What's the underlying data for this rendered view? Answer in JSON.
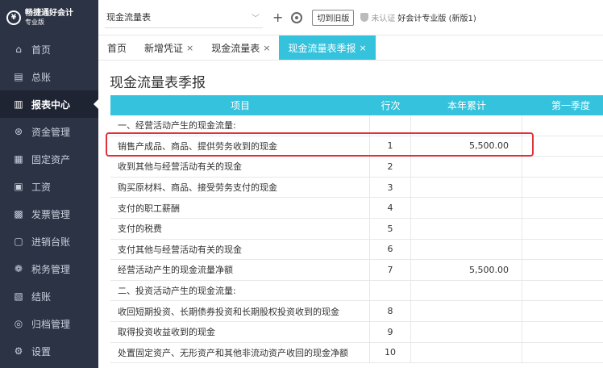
{
  "app": {
    "logo_glyph": "¥",
    "logo_name": "畅捷通好会计",
    "logo_sub": "专业版"
  },
  "sidebar": {
    "items": [
      {
        "label": "首页",
        "icon": "home-icon",
        "glyph": "⌂"
      },
      {
        "label": "总账",
        "icon": "ledger-icon",
        "glyph": "▤"
      },
      {
        "label": "报表中心",
        "icon": "chart-icon",
        "glyph": "▥",
        "active": true
      },
      {
        "label": "资金管理",
        "icon": "money-icon",
        "glyph": "⊛"
      },
      {
        "label": "固定资产",
        "icon": "asset-icon",
        "glyph": "▦"
      },
      {
        "label": "工资",
        "icon": "salary-icon",
        "glyph": "▣"
      },
      {
        "label": "发票管理",
        "icon": "invoice-icon",
        "glyph": "▩"
      },
      {
        "label": "进销台账",
        "icon": "inventory-icon",
        "glyph": "▢"
      },
      {
        "label": "税务管理",
        "icon": "tax-icon",
        "glyph": "❁"
      },
      {
        "label": "结账",
        "icon": "closing-icon",
        "glyph": "▧"
      },
      {
        "label": "归档管理",
        "icon": "archive-icon",
        "glyph": "◎"
      },
      {
        "label": "设置",
        "icon": "settings-icon",
        "glyph": "⚙"
      }
    ]
  },
  "topbar": {
    "account_name": "现金流量表",
    "add_glyph": "+",
    "old_version_label": "切到旧版",
    "verify_label": "未认证",
    "edition_label": "好会计专业版 (新版1)"
  },
  "tabs": [
    {
      "label": "首页",
      "closable": false
    },
    {
      "label": "新增凭证",
      "closable": true
    },
    {
      "label": "现金流量表",
      "closable": true
    },
    {
      "label": "现金流量表季报",
      "closable": true,
      "active": true
    }
  ],
  "close_glyph": "×",
  "page": {
    "title": "现金流量表季报"
  },
  "table": {
    "headers": [
      "项目",
      "行次",
      "本年累计",
      "第一季度"
    ],
    "rows": [
      {
        "item": "一、经营活动产生的现金流量:",
        "line": "",
        "amount": ""
      },
      {
        "item": "销售产成品、商品、提供劳务收到的现金",
        "line": "1",
        "amount": "5,500.00"
      },
      {
        "item": "收到其他与经营活动有关的现金",
        "line": "2",
        "amount": ""
      },
      {
        "item": "购买原材料、商品、接受劳务支付的现金",
        "line": "3",
        "amount": ""
      },
      {
        "item": "支付的职工薪酬",
        "line": "4",
        "amount": ""
      },
      {
        "item": "支付的税费",
        "line": "5",
        "amount": ""
      },
      {
        "item": "支付其他与经营活动有关的现金",
        "line": "6",
        "amount": ""
      },
      {
        "item": "经营活动产生的现金流量净额",
        "line": "7",
        "amount": "5,500.00"
      },
      {
        "item": "二、投资活动产生的现金流量:",
        "line": "",
        "amount": ""
      },
      {
        "item": "收回短期投资、长期债券投资和长期股权投资收到的现金",
        "line": "8",
        "amount": ""
      },
      {
        "item": "取得投资收益收到的现金",
        "line": "9",
        "amount": ""
      },
      {
        "item": "处置固定资产、无形资产和其他非流动资产收回的现金净额",
        "line": "10",
        "amount": ""
      }
    ]
  },
  "colors": {
    "accent": "#35c2dc",
    "sidebar_bg": "#2c3345",
    "highlight": "#e0313a"
  }
}
